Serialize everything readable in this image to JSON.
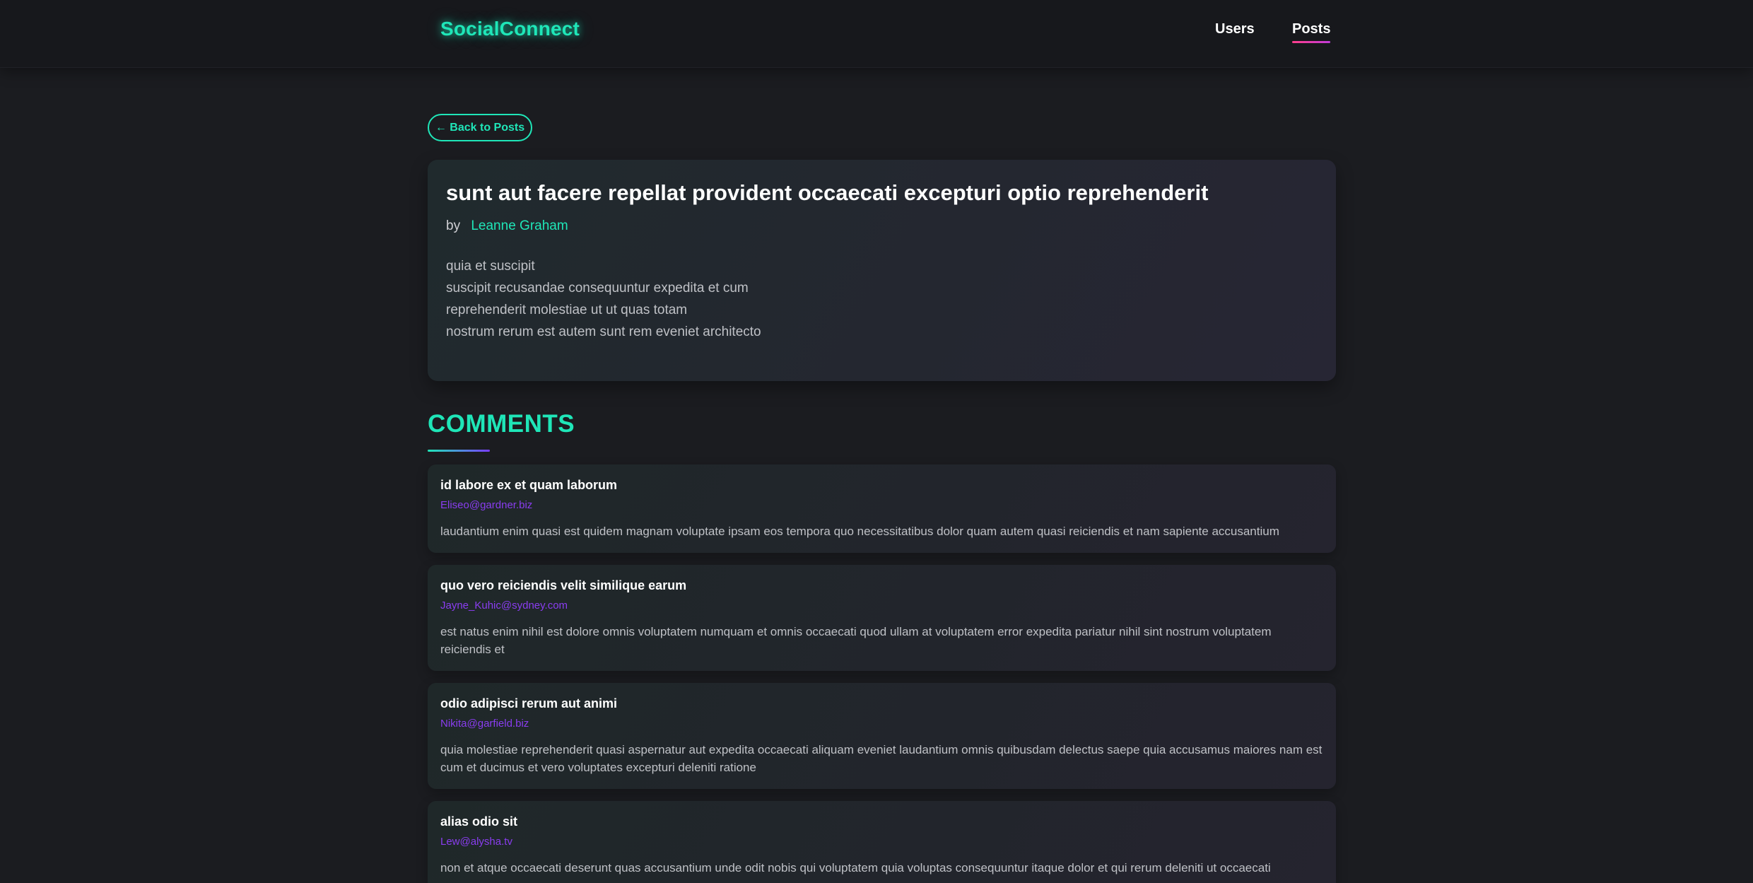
{
  "header": {
    "brand": "SocialConnect",
    "nav": [
      {
        "label": "Users",
        "active": false
      },
      {
        "label": "Posts",
        "active": true
      }
    ],
    "accent_color": "#1fe6b8",
    "active_underline_color": "#ff3e8a"
  },
  "back_button": {
    "label": "← Back to Posts"
  },
  "post": {
    "title": "sunt aut facere repellat provident occaecati excepturi optio reprehenderit",
    "by_prefix": "by",
    "author": "Leanne Graham",
    "body_lines": [
      "quia et suscipit",
      "suscipit recusandae consequuntur expedita et cum",
      "reprehenderit molestiae ut ut quas totam",
      "nostrum rerum est autem sunt rem eveniet architecto"
    ]
  },
  "comments_section": {
    "title": "COMMENTS",
    "items": [
      {
        "name": "id labore ex et quam laborum",
        "email": "Eliseo@gardner.biz",
        "body": "laudantium enim quasi est quidem magnam voluptate ipsam eos tempora quo necessitatibus dolor quam autem quasi reiciendis et nam sapiente accusantium"
      },
      {
        "name": "quo vero reiciendis velit similique earum",
        "email": "Jayne_Kuhic@sydney.com",
        "body": "est natus enim nihil est dolore omnis voluptatem numquam et omnis occaecati quod ullam at voluptatem error expedita pariatur nihil sint nostrum voluptatem reiciendis et"
      },
      {
        "name": "odio adipisci rerum aut animi",
        "email": "Nikita@garfield.biz",
        "body": "quia molestiae reprehenderit quasi aspernatur aut expedita occaecati aliquam eveniet laudantium omnis quibusdam delectus saepe quia accusamus maiores nam est cum et ducimus et vero voluptates excepturi deleniti ratione"
      },
      {
        "name": "alias odio sit",
        "email": "Lew@alysha.tv",
        "body": "non et atque occaecati deserunt quas accusantium unde odit nobis qui voluptatem quia voluptas consequuntur itaque dolor et qui rerum deleniti ut occaecati"
      }
    ],
    "email_color": "#8a3df0"
  }
}
